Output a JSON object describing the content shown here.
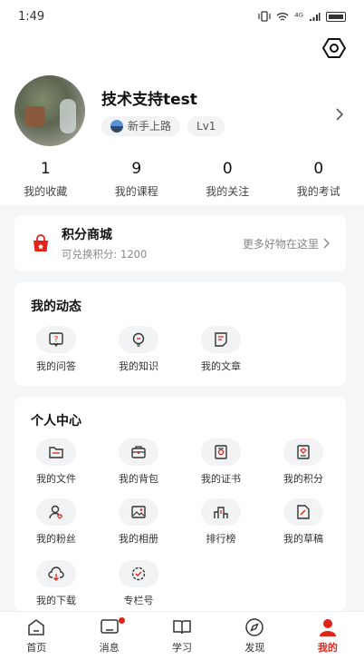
{
  "status_bar": {
    "time": "1:49",
    "signal_text": "⁴ᴳ"
  },
  "profile": {
    "name": "技术支持test",
    "level_tag": "新手上路",
    "level": "Lv1"
  },
  "stats": [
    {
      "count": "1",
      "label": "我的收藏"
    },
    {
      "count": "9",
      "label": "我的课程"
    },
    {
      "count": "0",
      "label": "我的关注"
    },
    {
      "count": "0",
      "label": "我的考试"
    }
  ],
  "shop": {
    "title": "积分商城",
    "subtitle": "可兑换积分: 1200",
    "more": "更多好物在这里",
    "accent": "#e2231a"
  },
  "dynamic": {
    "title": "我的动态",
    "items": [
      {
        "label": "我的问答",
        "icon": "question-icon"
      },
      {
        "label": "我的知识",
        "icon": "lightbulb-icon"
      },
      {
        "label": "我的文章",
        "icon": "article-icon"
      }
    ]
  },
  "personal": {
    "title": "个人中心",
    "items": [
      {
        "label": "我的文件",
        "icon": "folder-icon"
      },
      {
        "label": "我的背包",
        "icon": "briefcase-icon"
      },
      {
        "label": "我的证书",
        "icon": "certificate-icon"
      },
      {
        "label": "我的积分",
        "icon": "points-icon"
      },
      {
        "label": "我的粉丝",
        "icon": "fans-icon"
      },
      {
        "label": "我的相册",
        "icon": "album-icon"
      },
      {
        "label": "排行榜",
        "icon": "ranking-icon"
      },
      {
        "label": "我的草稿",
        "icon": "draft-icon"
      },
      {
        "label": "我的下载",
        "icon": "download-icon"
      },
      {
        "label": "专栏号",
        "icon": "column-icon"
      }
    ]
  },
  "tabbar": [
    {
      "label": "首页",
      "icon": "home-icon"
    },
    {
      "label": "消息",
      "icon": "message-icon",
      "badge": true
    },
    {
      "label": "学习",
      "icon": "book-icon"
    },
    {
      "label": "发现",
      "icon": "compass-icon"
    },
    {
      "label": "我的",
      "icon": "user-icon",
      "active": true
    }
  ]
}
